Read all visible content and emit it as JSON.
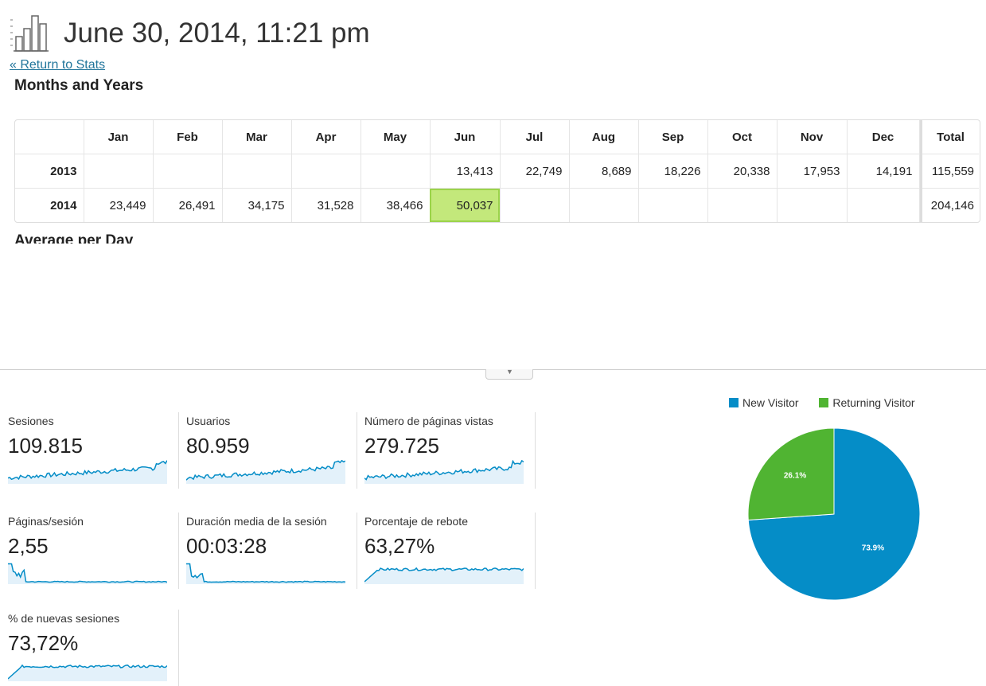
{
  "header": {
    "title": "June 30, 2014, 11:21 pm",
    "icon": "bar-chart-icon"
  },
  "return_link": "« Return to Stats",
  "section_title": "Months and Years",
  "table": {
    "columns": [
      "",
      "Jan",
      "Feb",
      "Mar",
      "Apr",
      "May",
      "Jun",
      "Jul",
      "Aug",
      "Sep",
      "Oct",
      "Nov",
      "Dec"
    ],
    "total_label": "Total",
    "rows": [
      {
        "year": "2013",
        "cells": [
          "",
          "",
          "",
          "",
          "",
          "13,413",
          "22,749",
          "8,689",
          "18,226",
          "20,338",
          "17,953",
          "14,191"
        ],
        "total": "115,559"
      },
      {
        "year": "2014",
        "cells": [
          "23,449",
          "26,491",
          "34,175",
          "31,528",
          "38,466",
          "50,037",
          "",
          "",
          "",
          "",
          "",
          ""
        ],
        "total": "204,146"
      }
    ],
    "highlight_color": "#c3e87b"
  },
  "next_heading": "Average per Day",
  "metrics": [
    {
      "label": "Sesiones",
      "value": "109.815",
      "trend": "rising"
    },
    {
      "label": "Usuarios",
      "value": "80.959",
      "trend": "rising"
    },
    {
      "label": "Número de páginas vistas",
      "value": "279.725",
      "trend": "rising"
    },
    {
      "label": "Páginas/sesión",
      "value": "2,55",
      "trend": "spike-flat"
    },
    {
      "label": "Duración media de la sesión",
      "value": "00:03:28",
      "trend": "spike-flat"
    },
    {
      "label": "Porcentaje de rebote",
      "value": "63,27%",
      "trend": "ramp-plateau"
    },
    {
      "label": "% de nuevas sesiones",
      "value": "73,72%",
      "trend": "ramp-plateau"
    }
  ],
  "sparkline_color": "#058dc7",
  "sparkline_fill": "#e3f1fa",
  "chart_data": {
    "type": "pie",
    "series": [
      {
        "name": "New Visitor",
        "value": 73.9,
        "label": "73.9%",
        "color": "#058dc7"
      },
      {
        "name": "Returning Visitor",
        "value": 26.1,
        "label": "26.1%",
        "color": "#50b432"
      }
    ],
    "legend_position": "top"
  }
}
